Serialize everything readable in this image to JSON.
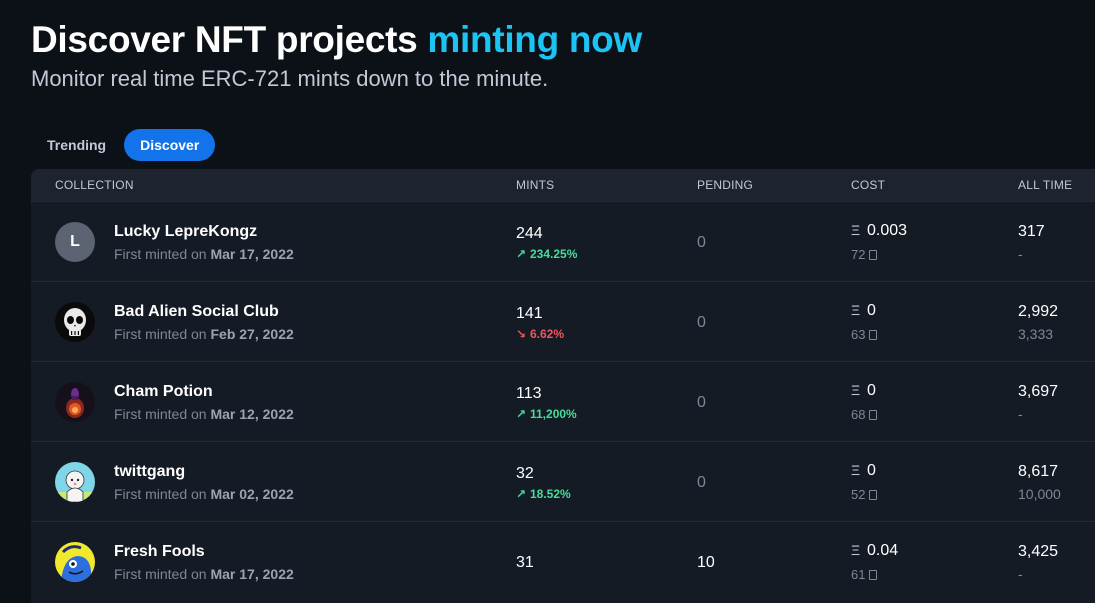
{
  "hero": {
    "title_main": "Discover NFT projects ",
    "title_accent": "minting now",
    "subtitle": "Monitor real time ERC-721 mints down to the minute."
  },
  "tabs": [
    {
      "label": "Trending",
      "active": false
    },
    {
      "label": "Discover",
      "active": true
    }
  ],
  "table": {
    "headers": {
      "collection": "COLLECTION",
      "mints": "MINTS",
      "pending": "PENDING",
      "cost": "COST",
      "all_time": "ALL TIME"
    },
    "first_minted_prefix": "First minted on",
    "eth_symbol": "Ξ",
    "rows": [
      {
        "name": "Lucky LepreKongz",
        "avatar_letter": "L",
        "first_minted": "Mar 17, 2022",
        "mints": "244",
        "change": "234.25%",
        "change_dir": "up",
        "pending": "0",
        "cost": "0.003",
        "gas": "72",
        "all_time": "317",
        "supply": "-"
      },
      {
        "name": "Bad Alien Social Club",
        "avatar_letter": "",
        "first_minted": "Feb 27, 2022",
        "mints": "141",
        "change": "6.62%",
        "change_dir": "down",
        "pending": "0",
        "cost": "0",
        "gas": "63",
        "all_time": "2,992",
        "supply": "3,333"
      },
      {
        "name": "Cham Potion",
        "avatar_letter": "",
        "first_minted": "Mar 12, 2022",
        "mints": "113",
        "change": "11,200%",
        "change_dir": "up",
        "pending": "0",
        "cost": "0",
        "gas": "68",
        "all_time": "3,697",
        "supply": "-"
      },
      {
        "name": "twittgang",
        "avatar_letter": "",
        "first_minted": "Mar 02, 2022",
        "mints": "32",
        "change": "18.52%",
        "change_dir": "up",
        "pending": "0",
        "cost": "0",
        "gas": "52",
        "all_time": "8,617",
        "supply": "10,000"
      },
      {
        "name": "Fresh Fools",
        "avatar_letter": "",
        "first_minted": "Mar 17, 2022",
        "mints": "31",
        "change": "",
        "change_dir": "none",
        "pending": "10",
        "cost": "0.04",
        "gas": "61",
        "all_time": "3,425",
        "supply": "-"
      }
    ]
  },
  "colors": {
    "background": "#0c1017",
    "accent": "#1cc4f4",
    "tab_active": "#1273ea",
    "up": "#45dd9a",
    "down": "#f0555d"
  }
}
